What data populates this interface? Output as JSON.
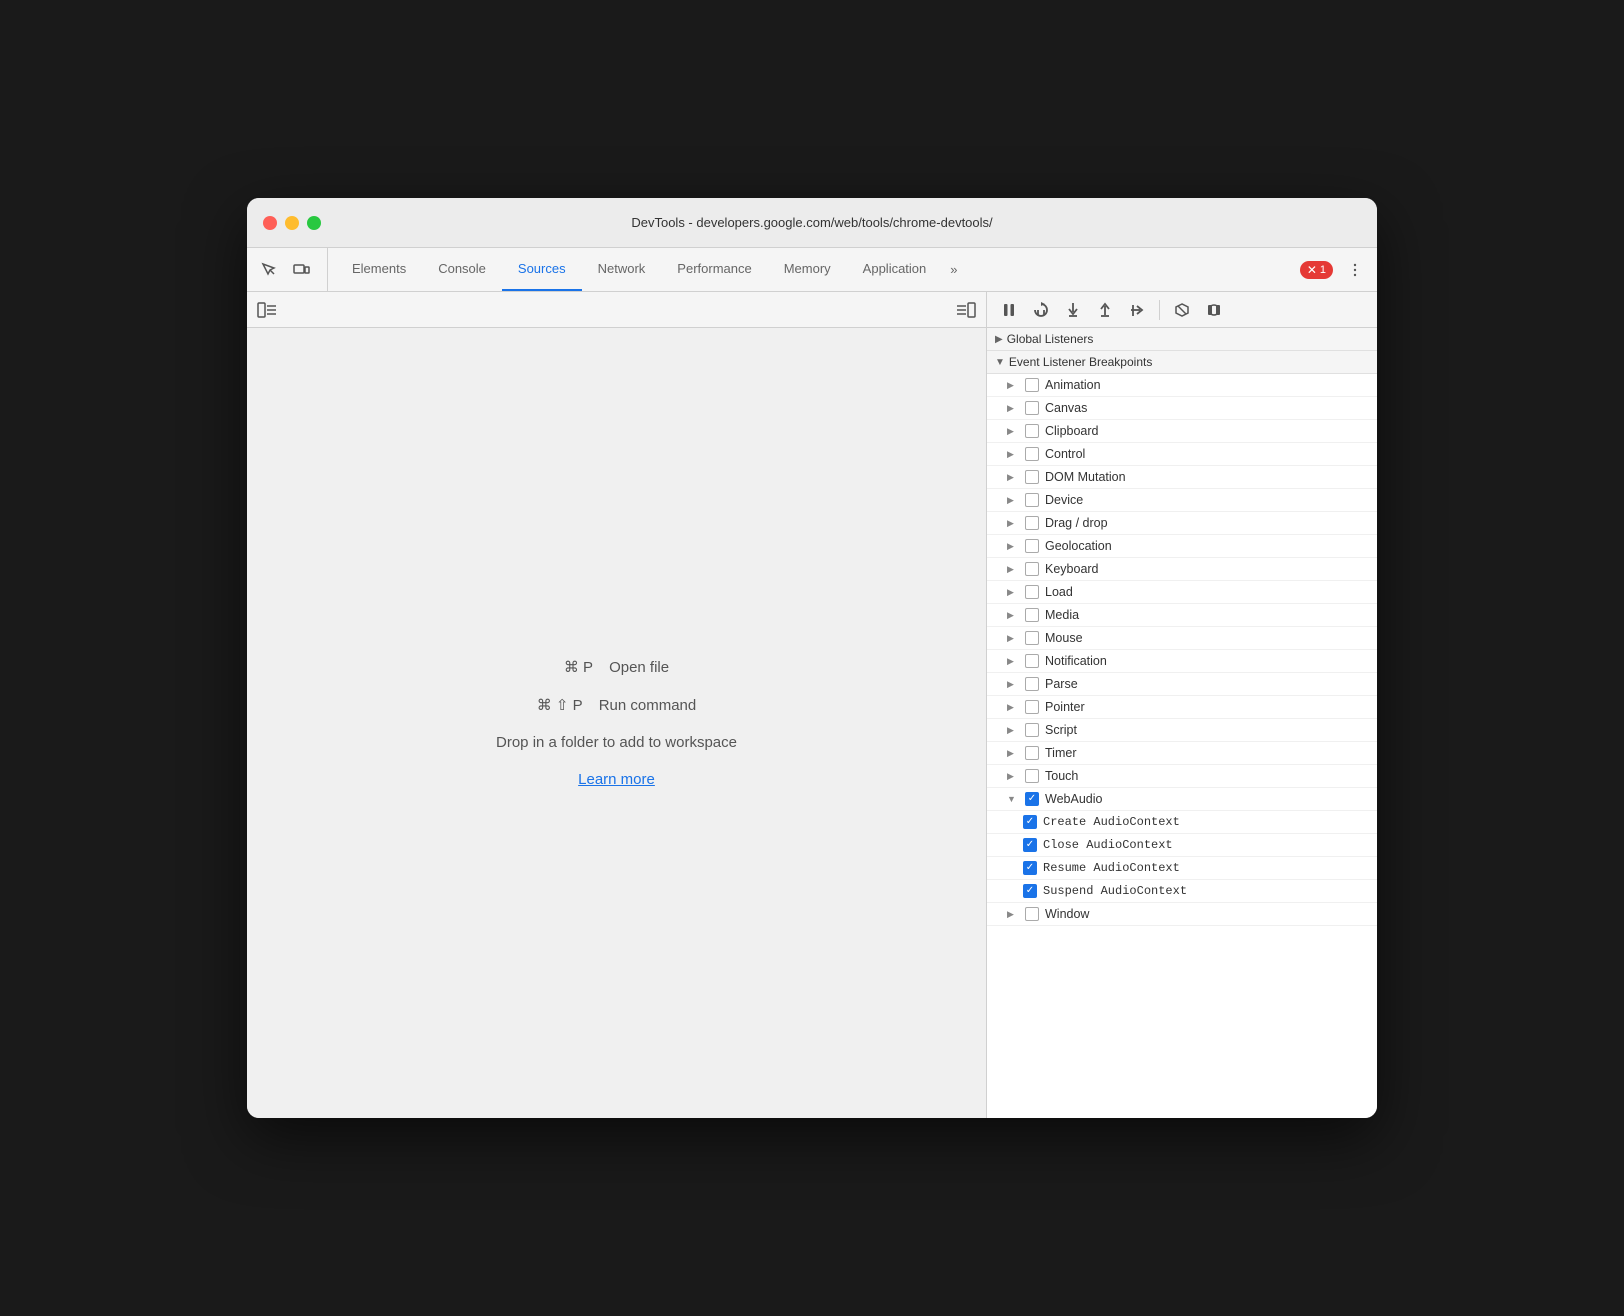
{
  "window": {
    "title": "DevTools - developers.google.com/web/tools/chrome-devtools/"
  },
  "tabs": [
    {
      "label": "Elements",
      "active": false
    },
    {
      "label": "Console",
      "active": false
    },
    {
      "label": "Sources",
      "active": true
    },
    {
      "label": "Network",
      "active": false
    },
    {
      "label": "Performance",
      "active": false
    },
    {
      "label": "Memory",
      "active": false
    },
    {
      "label": "Application",
      "active": false
    }
  ],
  "tab_more": "»",
  "error_badge": "1",
  "sources": {
    "open_file_keys": "⌘ P",
    "open_file_label": "Open file",
    "run_command_keys": "⌘ ⇧ P",
    "run_command_label": "Run command",
    "drop_text": "Drop in a folder to add to workspace",
    "learn_more": "Learn more"
  },
  "debugger": {
    "pause_label": "⏸",
    "step_over": "↺",
    "step_into": "↓",
    "step_out": "↑",
    "step": "→",
    "deactivate": "⚡",
    "pause_exceptions": "⏸"
  },
  "breakpoints": {
    "global_listeners_label": "Global Listeners",
    "event_listener_label": "Event Listener Breakpoints",
    "items": [
      {
        "label": "Animation",
        "checked": false,
        "expanded": false
      },
      {
        "label": "Canvas",
        "checked": false,
        "expanded": false
      },
      {
        "label": "Clipboard",
        "checked": false,
        "expanded": false
      },
      {
        "label": "Control",
        "checked": false,
        "expanded": false
      },
      {
        "label": "DOM Mutation",
        "checked": false,
        "expanded": false
      },
      {
        "label": "Device",
        "checked": false,
        "expanded": false
      },
      {
        "label": "Drag / drop",
        "checked": false,
        "expanded": false
      },
      {
        "label": "Geolocation",
        "checked": false,
        "expanded": false
      },
      {
        "label": "Keyboard",
        "checked": false,
        "expanded": false
      },
      {
        "label": "Load",
        "checked": false,
        "expanded": false
      },
      {
        "label": "Media",
        "checked": false,
        "expanded": false
      },
      {
        "label": "Mouse",
        "checked": false,
        "expanded": false
      },
      {
        "label": "Notification",
        "checked": false,
        "expanded": false
      },
      {
        "label": "Parse",
        "checked": false,
        "expanded": false
      },
      {
        "label": "Pointer",
        "checked": false,
        "expanded": false
      },
      {
        "label": "Script",
        "checked": false,
        "expanded": false
      },
      {
        "label": "Timer",
        "checked": false,
        "expanded": false
      },
      {
        "label": "Touch",
        "checked": false,
        "expanded": false
      },
      {
        "label": "WebAudio",
        "checked": true,
        "expanded": true
      },
      {
        "label": "Window",
        "checked": false,
        "expanded": false
      }
    ],
    "webaudio_children": [
      {
        "label": "Create AudioContext",
        "checked": true
      },
      {
        "label": "Close AudioContext",
        "checked": true
      },
      {
        "label": "Resume AudioContext",
        "checked": true
      },
      {
        "label": "Suspend AudioContext",
        "checked": true
      }
    ]
  }
}
